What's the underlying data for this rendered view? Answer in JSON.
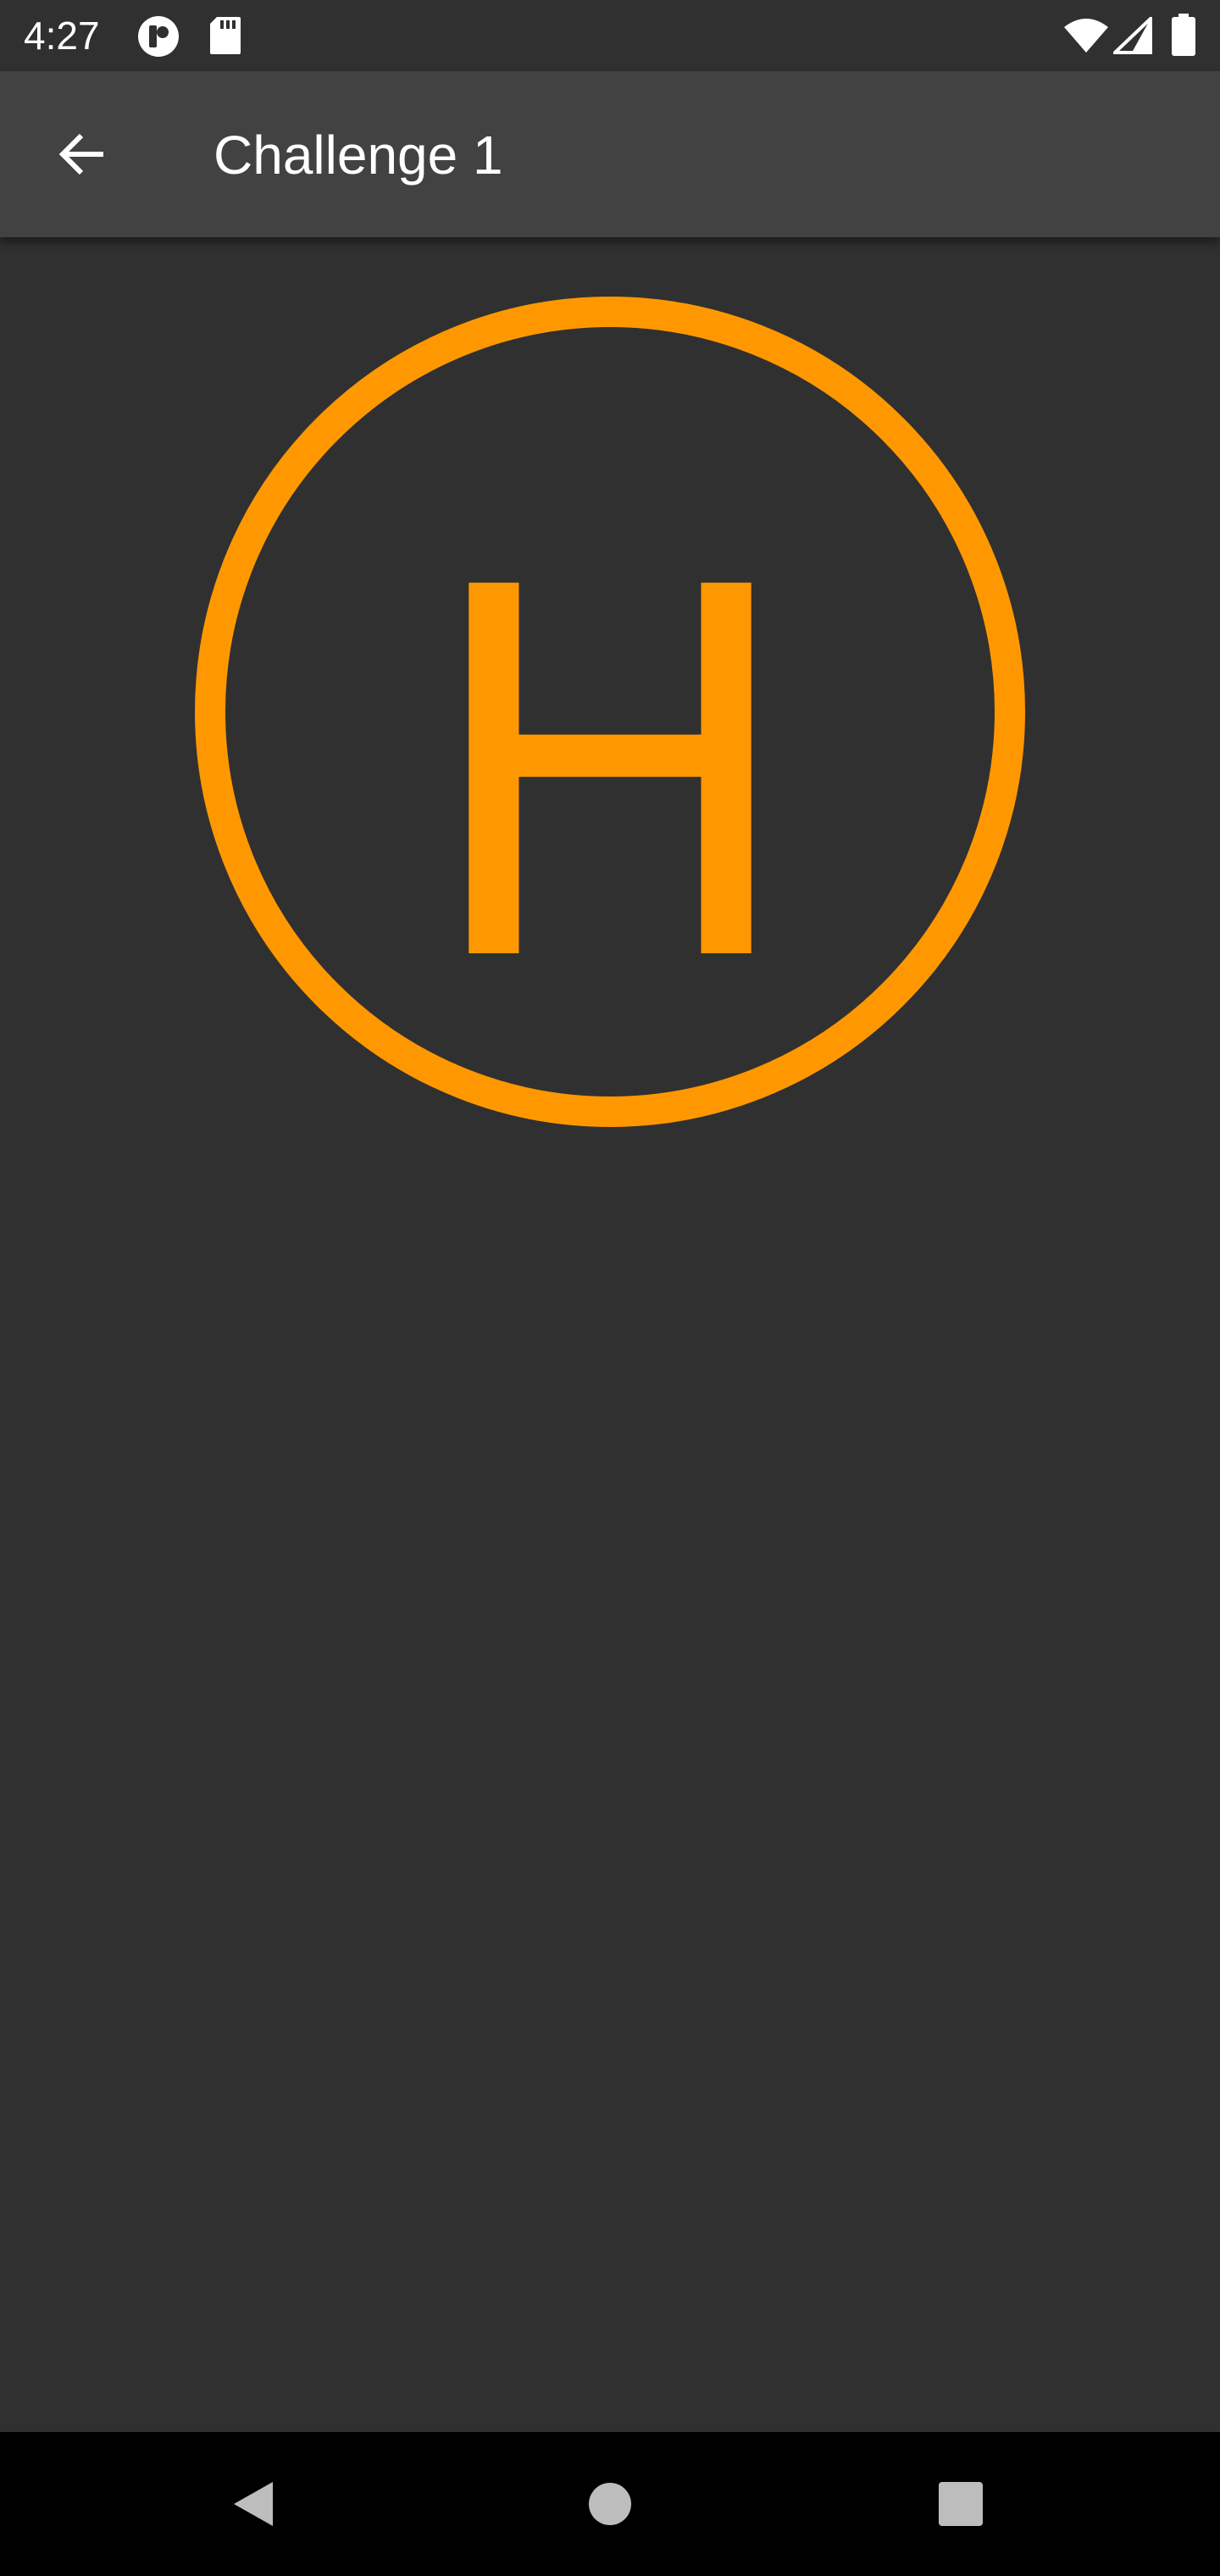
{
  "status_bar": {
    "time": "4:27",
    "left_icons": [
      "pocket-casts-icon",
      "sd-card-icon"
    ],
    "right_icons": [
      "wifi-icon",
      "cell-signal-icon",
      "battery-icon"
    ]
  },
  "app_bar": {
    "back_icon": "arrow-back-icon",
    "title": "Challenge 1"
  },
  "content": {
    "letter": "H",
    "accent_color": "#FF9800"
  },
  "nav_bar": {
    "buttons": [
      "back-triangle-icon",
      "home-circle-icon",
      "recents-square-icon"
    ]
  },
  "colors": {
    "background": "#303030",
    "app_bar": "#424242",
    "nav_bar": "#000000",
    "accent": "#FF9800"
  }
}
